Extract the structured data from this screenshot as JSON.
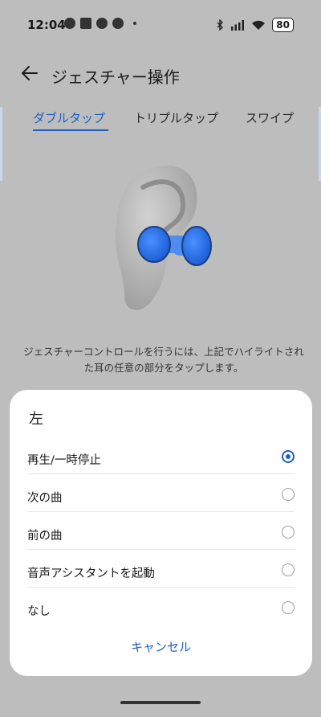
{
  "status_bar": {
    "time": "12:04",
    "battery": "80",
    "icons": [
      "sync-icon",
      "notification-icon",
      "cat-icon",
      "chat-icon"
    ],
    "right_icons": [
      "bluetooth-icon",
      "signal-icon",
      "wifi-icon",
      "battery-icon"
    ]
  },
  "header": {
    "title": "ジェスチャー操作",
    "back_icon": "arrow-left-icon"
  },
  "tabs": [
    {
      "label": "ダブルタップ",
      "active": true
    },
    {
      "label": "トリプルタップ",
      "active": false
    },
    {
      "label": "スワイプ",
      "active": false
    }
  ],
  "caption": "ジェスチャーコントロールを行うには、上記でハイライトされた耳の任意の部分をタップします。",
  "sheet": {
    "title": "左",
    "options": [
      {
        "label": "再生/一時停止",
        "selected": true
      },
      {
        "label": "次の曲",
        "selected": false
      },
      {
        "label": "前の曲",
        "selected": false
      },
      {
        "label": "音声アシスタントを起動",
        "selected": false
      },
      {
        "label": "なし",
        "selected": false
      }
    ],
    "cancel_label": "キャンセル"
  },
  "colors": {
    "accent": "#1f5fc2",
    "scrim_bg": "#bdbdbd",
    "sheet_bg": "#ffffff"
  }
}
